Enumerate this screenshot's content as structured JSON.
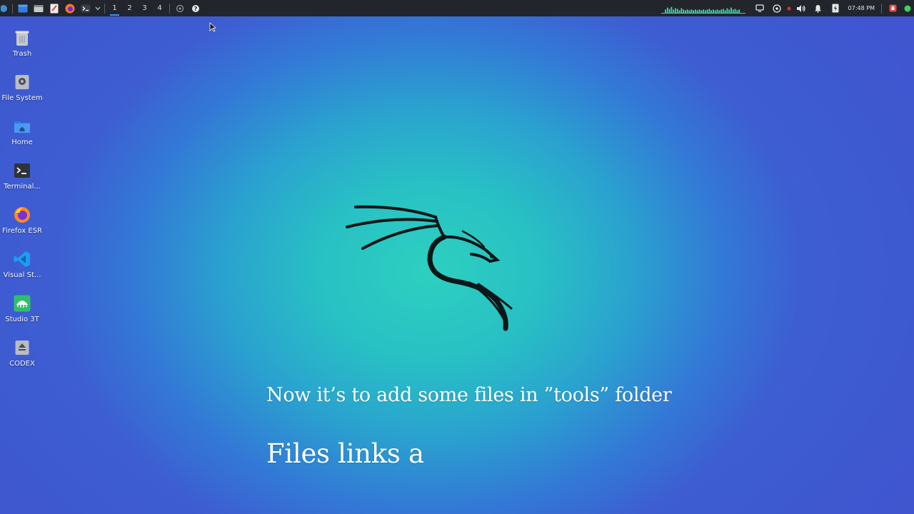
{
  "panel": {
    "workspaces": [
      "1",
      "2",
      "3",
      "4"
    ],
    "active_workspace": "1",
    "clock": "07:48 PM"
  },
  "desktop_icons": [
    {
      "label": "Trash",
      "icon": "trash-icon"
    },
    {
      "label": "File System",
      "icon": "drive-icon"
    },
    {
      "label": "Home",
      "icon": "home-folder-icon"
    },
    {
      "label": "Terminal...",
      "icon": "terminal-icon"
    },
    {
      "label": "Firefox ESR",
      "icon": "firefox-icon"
    },
    {
      "label": "Visual St...",
      "icon": "vscode-icon"
    },
    {
      "label": "Studio 3T",
      "icon": "studio3t-icon"
    },
    {
      "label": "CODEX",
      "icon": "drive-eject-icon"
    }
  ],
  "captions": {
    "line1": "Now it’s to add some files in ”tools” folder",
    "line2": "Files links a"
  },
  "colors": {
    "panel_bg": "#22252b",
    "accent": "#3d8ff0",
    "cpu_graph": "#3fd4a4",
    "wallpaper_center": "#2dd0c0",
    "wallpaper_edge": "#3d5fd2"
  }
}
